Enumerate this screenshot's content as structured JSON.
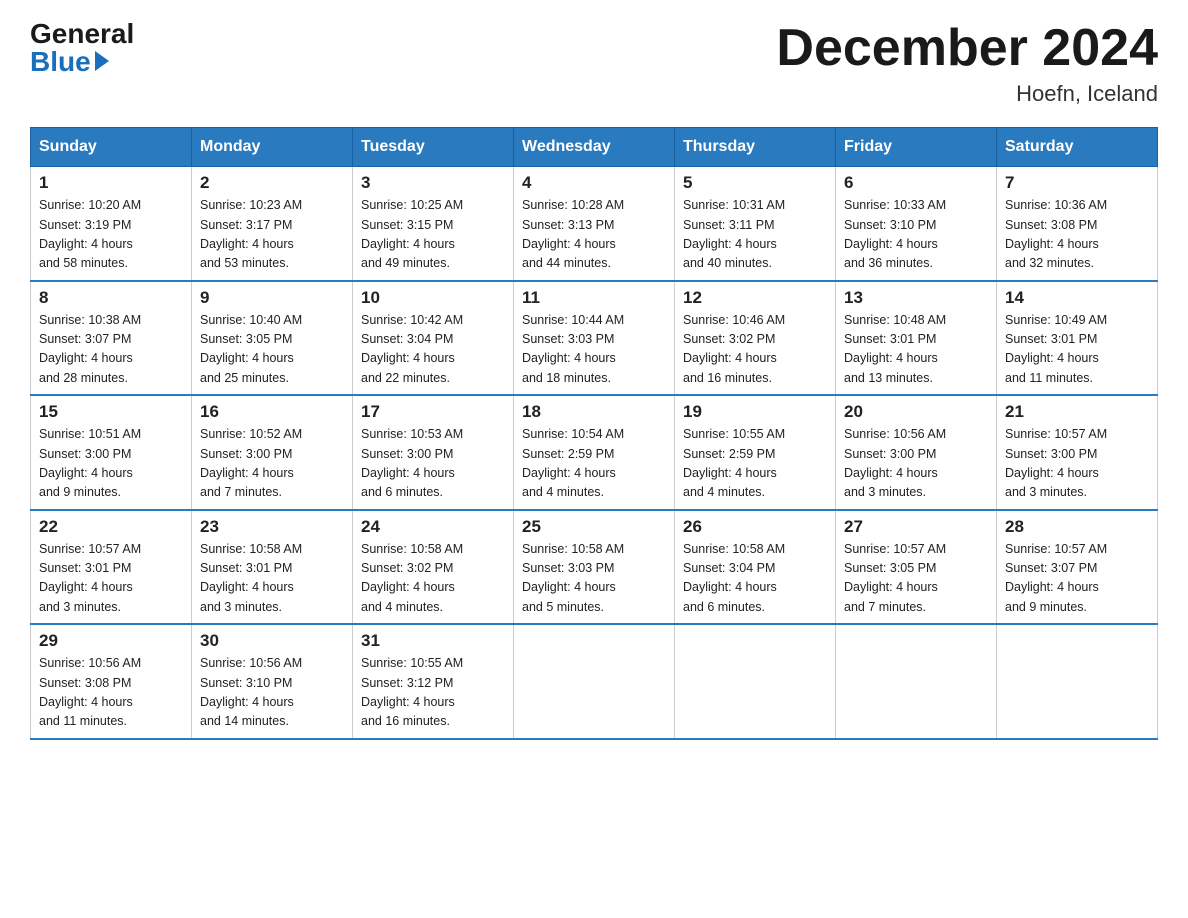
{
  "header": {
    "logo_general": "General",
    "logo_blue": "Blue",
    "title": "December 2024",
    "location": "Hoefn, Iceland"
  },
  "weekdays": [
    "Sunday",
    "Monday",
    "Tuesday",
    "Wednesday",
    "Thursday",
    "Friday",
    "Saturday"
  ],
  "weeks": [
    [
      {
        "day": "1",
        "sunrise": "10:20 AM",
        "sunset": "3:19 PM",
        "daylight": "4 hours and 58 minutes."
      },
      {
        "day": "2",
        "sunrise": "10:23 AM",
        "sunset": "3:17 PM",
        "daylight": "4 hours and 53 minutes."
      },
      {
        "day": "3",
        "sunrise": "10:25 AM",
        "sunset": "3:15 PM",
        "daylight": "4 hours and 49 minutes."
      },
      {
        "day": "4",
        "sunrise": "10:28 AM",
        "sunset": "3:13 PM",
        "daylight": "4 hours and 44 minutes."
      },
      {
        "day": "5",
        "sunrise": "10:31 AM",
        "sunset": "3:11 PM",
        "daylight": "4 hours and 40 minutes."
      },
      {
        "day": "6",
        "sunrise": "10:33 AM",
        "sunset": "3:10 PM",
        "daylight": "4 hours and 36 minutes."
      },
      {
        "day": "7",
        "sunrise": "10:36 AM",
        "sunset": "3:08 PM",
        "daylight": "4 hours and 32 minutes."
      }
    ],
    [
      {
        "day": "8",
        "sunrise": "10:38 AM",
        "sunset": "3:07 PM",
        "daylight": "4 hours and 28 minutes."
      },
      {
        "day": "9",
        "sunrise": "10:40 AM",
        "sunset": "3:05 PM",
        "daylight": "4 hours and 25 minutes."
      },
      {
        "day": "10",
        "sunrise": "10:42 AM",
        "sunset": "3:04 PM",
        "daylight": "4 hours and 22 minutes."
      },
      {
        "day": "11",
        "sunrise": "10:44 AM",
        "sunset": "3:03 PM",
        "daylight": "4 hours and 18 minutes."
      },
      {
        "day": "12",
        "sunrise": "10:46 AM",
        "sunset": "3:02 PM",
        "daylight": "4 hours and 16 minutes."
      },
      {
        "day": "13",
        "sunrise": "10:48 AM",
        "sunset": "3:01 PM",
        "daylight": "4 hours and 13 minutes."
      },
      {
        "day": "14",
        "sunrise": "10:49 AM",
        "sunset": "3:01 PM",
        "daylight": "4 hours and 11 minutes."
      }
    ],
    [
      {
        "day": "15",
        "sunrise": "10:51 AM",
        "sunset": "3:00 PM",
        "daylight": "4 hours and 9 minutes."
      },
      {
        "day": "16",
        "sunrise": "10:52 AM",
        "sunset": "3:00 PM",
        "daylight": "4 hours and 7 minutes."
      },
      {
        "day": "17",
        "sunrise": "10:53 AM",
        "sunset": "3:00 PM",
        "daylight": "4 hours and 6 minutes."
      },
      {
        "day": "18",
        "sunrise": "10:54 AM",
        "sunset": "2:59 PM",
        "daylight": "4 hours and 4 minutes."
      },
      {
        "day": "19",
        "sunrise": "10:55 AM",
        "sunset": "2:59 PM",
        "daylight": "4 hours and 4 minutes."
      },
      {
        "day": "20",
        "sunrise": "10:56 AM",
        "sunset": "3:00 PM",
        "daylight": "4 hours and 3 minutes."
      },
      {
        "day": "21",
        "sunrise": "10:57 AM",
        "sunset": "3:00 PM",
        "daylight": "4 hours and 3 minutes."
      }
    ],
    [
      {
        "day": "22",
        "sunrise": "10:57 AM",
        "sunset": "3:01 PM",
        "daylight": "4 hours and 3 minutes."
      },
      {
        "day": "23",
        "sunrise": "10:58 AM",
        "sunset": "3:01 PM",
        "daylight": "4 hours and 3 minutes."
      },
      {
        "day": "24",
        "sunrise": "10:58 AM",
        "sunset": "3:02 PM",
        "daylight": "4 hours and 4 minutes."
      },
      {
        "day": "25",
        "sunrise": "10:58 AM",
        "sunset": "3:03 PM",
        "daylight": "4 hours and 5 minutes."
      },
      {
        "day": "26",
        "sunrise": "10:58 AM",
        "sunset": "3:04 PM",
        "daylight": "4 hours and 6 minutes."
      },
      {
        "day": "27",
        "sunrise": "10:57 AM",
        "sunset": "3:05 PM",
        "daylight": "4 hours and 7 minutes."
      },
      {
        "day": "28",
        "sunrise": "10:57 AM",
        "sunset": "3:07 PM",
        "daylight": "4 hours and 9 minutes."
      }
    ],
    [
      {
        "day": "29",
        "sunrise": "10:56 AM",
        "sunset": "3:08 PM",
        "daylight": "4 hours and 11 minutes."
      },
      {
        "day": "30",
        "sunrise": "10:56 AM",
        "sunset": "3:10 PM",
        "daylight": "4 hours and 14 minutes."
      },
      {
        "day": "31",
        "sunrise": "10:55 AM",
        "sunset": "3:12 PM",
        "daylight": "4 hours and 16 minutes."
      },
      null,
      null,
      null,
      null
    ]
  ]
}
